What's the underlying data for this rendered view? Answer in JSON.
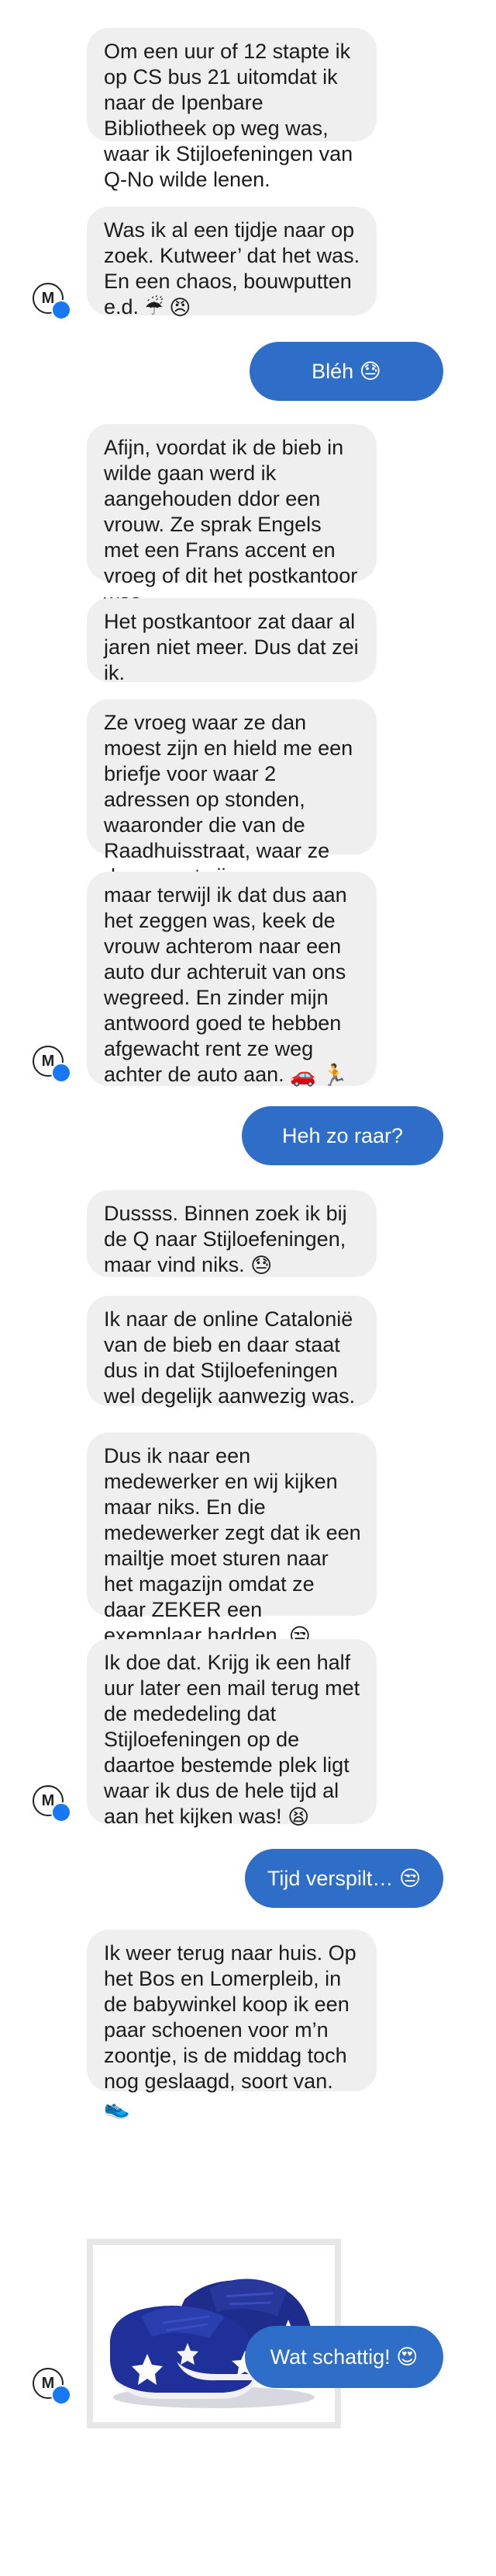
{
  "avatar": {
    "letter": "M"
  },
  "messages": [
    {
      "text": "Om een uur of 12 stapte ik op CS bus 21 uitomdat ik naar de Ipenbare Bibliotheek op weg was, waar ik Stijloefeningen van Q-No wilde lenen."
    },
    {
      "text": "Was ik al een tijdje naar op zoek. Kutweer’ dat het was. En een chaos, bouwputten e.d.",
      "emoji": "☔ 😠"
    },
    {
      "text": "Bléh",
      "emoji": "😓"
    },
    {
      "text": "Afijn, voordat ik de bieb in wilde gaan werd ik aangehouden ddor een vrouw. Ze sprak Engels met een Frans accent en vroeg of dit het postkantoor was."
    },
    {
      "text": "Het postkantoor zat daar al jaren niet meer. Dus dat zei ik."
    },
    {
      "text": "Ze vroeg waar ze dan moest zijn en hield me een briefje voor waar 2 adressen op stonden, waaronder die van de Raadhuisstraat, waar ze dus moest zijn,"
    },
    {
      "text": "maar terwijl ik dat dus aan het zeggen was, keek de vrouw achterom naar een auto dur achteruit van ons wegreed. En zinder mijn antwoord goed te hebben afgewacht rent ze weg achter de auto aan.",
      "emoji": "🚗 🏃"
    },
    {
      "text": "Heh zo raar?"
    },
    {
      "text": "Dussss. Binnen zoek ik bij de Q naar Stijloefeningen, maar vind niks.",
      "emoji": "😓"
    },
    {
      "text": "Ik naar de online Catalonië van de bieb en daar staat dus in dat Stijloefeningen wel degelijk aanwezig was."
    },
    {
      "text": "Dus ik naar een medewerker en wij kijken maar niks. En die medewerker zegt dat ik een mailtje moet sturen naar het magazijn omdat ze daar ZEKER een exemplaar hadden.",
      "emoji": "😒"
    },
    {
      "text": "Ik doe dat. Krijg ik een half uur later een mail terug met de mededeling dat Stijloefeningen op de daartoe bestemde plek ligt waar ik dus de hele tijd al aan het kijken was!",
      "emoji": "😫"
    },
    {
      "text": "Tijd verspilt…",
      "emoji": "😒"
    },
    {
      "text": "Ik weer terug naar huis. Op het Bos en Lomerpleib, in de babywinkel koop ik een paar schoenen voor m’n zoontje, is de middag toch nog geslaagd, soort van.",
      "emoji": "👟"
    },
    {
      "text": "Wat schattig!",
      "emoji": "😍"
    }
  ],
  "icons": {
    "avatar": "avatar-m-icon",
    "badge": "messenger-badge-icon",
    "photo": "baby-shoes-photo"
  }
}
